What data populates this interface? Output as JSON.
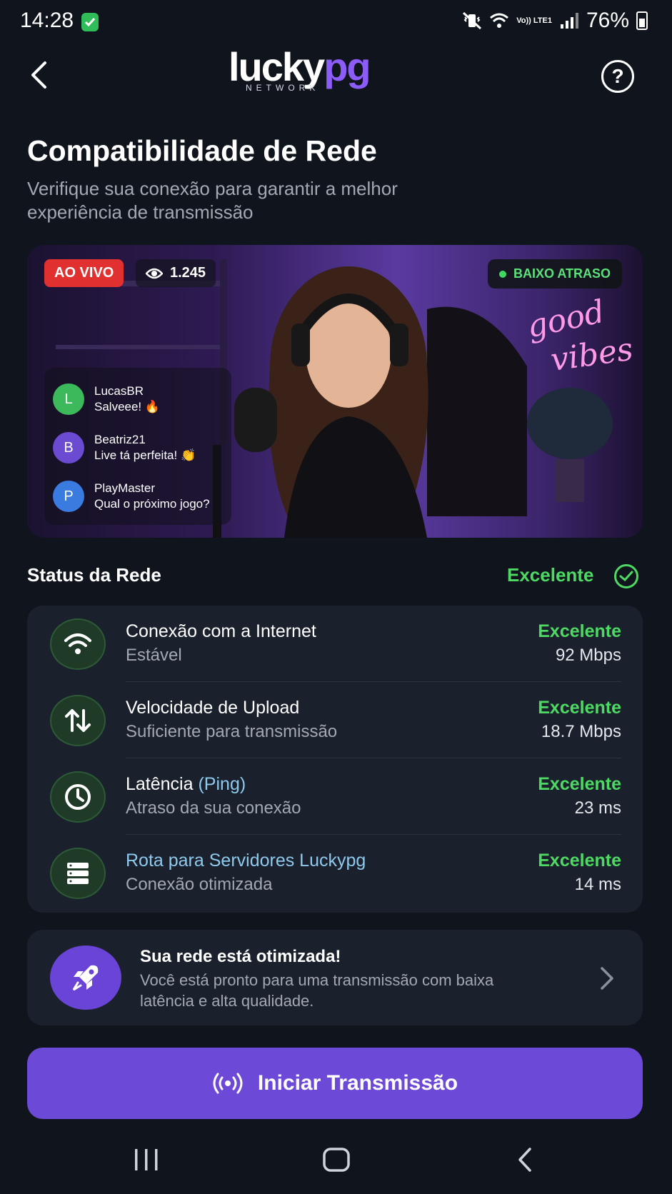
{
  "status_bar": {
    "time": "14:28",
    "battery": "76%",
    "network_label": "Vo)) LTE1",
    "icons": [
      "shield-check-icon",
      "vibrate-mute-icon",
      "wifi-icon",
      "volte-icon",
      "signal-icon",
      "battery-icon"
    ]
  },
  "header": {
    "logo_main_1": "lucky",
    "logo_main_2": "pg",
    "logo_sub": "NETWORK",
    "help_label": "?"
  },
  "page": {
    "title": "Compatibilidade de Rede",
    "subtitle": "Verifique sua conexão para garantir a melhor experiência de transmissão"
  },
  "preview": {
    "live_label": "AO VIVO",
    "viewers": "1.245",
    "latency_label": "BAIXO ATRASO",
    "neon_text": "good vibes",
    "chat": [
      {
        "initial": "L",
        "name": "LucasBR",
        "message": "Salveee! 🔥",
        "color": "#3cb95a"
      },
      {
        "initial": "B",
        "name": "Beatriz21",
        "message": "Live tá perfeita! 👏",
        "color": "#6a4bd1"
      },
      {
        "initial": "P",
        "name": "PlayMaster",
        "message": "Qual o próximo jogo?",
        "color": "#3a7be0"
      }
    ]
  },
  "network_status": {
    "title": "Status da Rede",
    "overall": "Excelente",
    "metrics": [
      {
        "icon": "wifi-icon",
        "name": "Conexão com a Internet",
        "sub": "Estável",
        "rating": "Excelente",
        "value": "92 Mbps"
      },
      {
        "icon": "upload-download-arrows-icon",
        "name": "Velocidade de Upload",
        "sub": "Suficiente para transmissão",
        "rating": "Excelente",
        "value": "18.7 Mbps"
      },
      {
        "icon": "clock-icon",
        "name": "Latência",
        "name_accent": "(Ping)",
        "sub": "Atraso da sua conexão",
        "rating": "Excelente",
        "value": "23 ms"
      },
      {
        "icon": "server-icon",
        "name": "Rota para Servidores Luckypg",
        "sub": "Conexão otimizada",
        "rating": "Excelente",
        "value": "14 ms"
      }
    ]
  },
  "optimized": {
    "title": "Sua rede está otimizada!",
    "text": "Você está pronto para uma transmissão com baixa latência e alta qualidade."
  },
  "cta": {
    "label": "Iniciar Transmissão"
  },
  "colors": {
    "background": "#0f141d",
    "card": "#1a212c",
    "success": "#4ed964",
    "accent_purple": "#6d49d8",
    "live_red": "#e0302f",
    "accent_blue": "#8ec9ee"
  }
}
